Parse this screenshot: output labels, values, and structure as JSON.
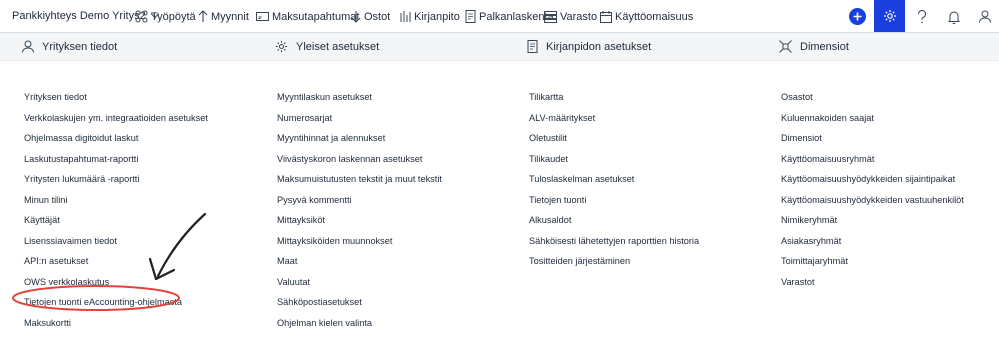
{
  "topbar": {
    "company": "Pankkiyhteys Demo Yritys2",
    "nav": [
      "Työpöytä",
      "Myynnit",
      "Maksutapahtumat",
      "Ostot",
      "Kirjanpito",
      "Palkanlaskenta",
      "Varasto",
      "Käyttöomaisuus"
    ],
    "icons": [
      "add-icon",
      "gear-icon",
      "help-icon",
      "bell-icon",
      "user-icon"
    ],
    "accent_color": "#1a3fdc"
  },
  "sections": [
    "Yrityksen tiedot",
    "Yleiset asetukset",
    "Kirjanpidon asetukset",
    "Dimensiot"
  ],
  "columns": [
    [
      "Yrityksen tiedot",
      "Verkkolaskujen ym. integraatioiden asetukset",
      "Ohjelmassa digitoidut laskut",
      "Laskutustapahtumat-raportti",
      "Yritysten lukumäärä -raportti",
      "Minun tilini",
      "Käyttäjät",
      "Lisenssiavaimen tiedot",
      "API:n asetukset",
      "OWS verkkolaskutus",
      "Tietojen tuonti eAccounting-ohjelmasta",
      "Maksukortti"
    ],
    [
      "Myyntilaskun asetukset",
      "Numerosarjat",
      "Myyntihinnat ja alennukset",
      "Viivästyskoron laskennan asetukset",
      "Maksumuistutusten tekstit ja muut tekstit",
      "Pysyvä kommentti",
      "Mittayksiköt",
      "Mittayksiköiden muunnokset",
      "Maat",
      "Valuutat",
      "Sähköpostiasetukset",
      "Ohjelman kielen valinta"
    ],
    [
      "Tilikartta",
      "ALV-määritykset",
      "Oletustilit",
      "Tilikaudet",
      "Tuloslaskelman asetukset",
      "Tietojen tuonti",
      "Alkusaldot",
      "Sähköisesti lähetettyjen raporttien historia",
      "Tositteiden järjestäminen"
    ],
    [
      "Osastot",
      "Kuluennakoiden saajat",
      "Dimensiot",
      "Käyttöomaisuusryhmät",
      "Käyttöomaisuushyödykkeiden sijaintipaikat",
      "Käyttöomaisuushyödykkeiden vastuuhenkilöt",
      "Nimikeryhmät",
      "Asiakasryhmät",
      "Toimittajaryhmät",
      "Varastot"
    ]
  ],
  "annotation": {
    "highlighted_item": "Tietojen tuonti eAccounting-ohjelmasta",
    "ellipse_color": "#e0443c",
    "arrow_color": "#222222"
  }
}
